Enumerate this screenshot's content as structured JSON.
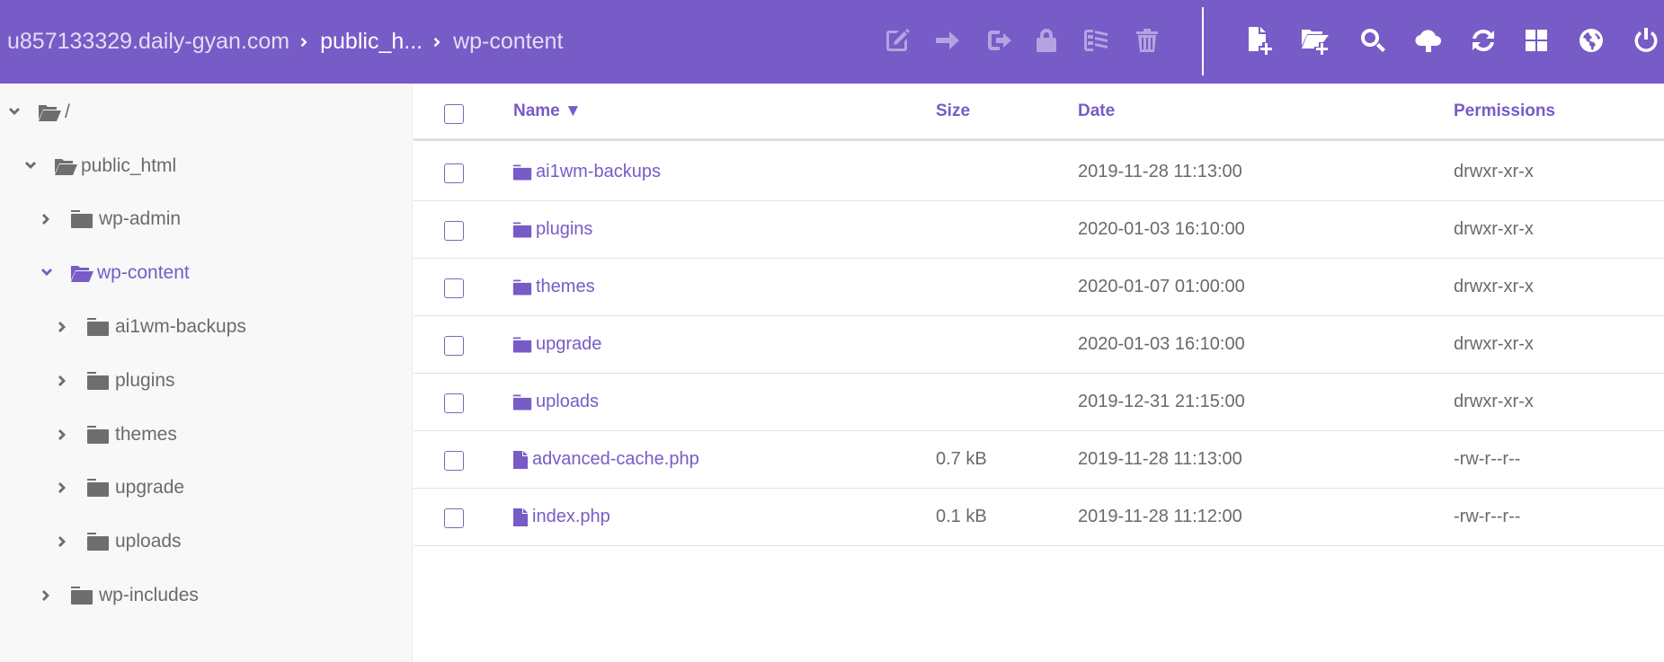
{
  "header": {
    "breadcrumb": [
      {
        "label": "u857133329.daily-gyan.com"
      },
      {
        "label": "public_h..."
      },
      {
        "label": "wp-content"
      }
    ],
    "toolbar_selection_actions": [
      {
        "icon": "edit-icon",
        "label": "Rename",
        "enabled": false
      },
      {
        "icon": "arrow-right-icon",
        "label": "Move",
        "enabled": false
      },
      {
        "icon": "copy-icon",
        "label": "Copy",
        "enabled": false
      },
      {
        "icon": "lock-icon",
        "label": "Permissions",
        "enabled": false
      },
      {
        "icon": "archive-icon",
        "label": "Archive",
        "enabled": false
      },
      {
        "icon": "trash-icon",
        "label": "Delete",
        "enabled": false
      }
    ],
    "toolbar_actions": [
      {
        "icon": "new-file-icon",
        "label": "New file"
      },
      {
        "icon": "new-folder-icon",
        "label": "New folder"
      },
      {
        "icon": "search-icon",
        "label": "Search"
      },
      {
        "icon": "upload-icon",
        "label": "Upload"
      },
      {
        "icon": "refresh-icon",
        "label": "Refresh"
      },
      {
        "icon": "grid-view-icon",
        "label": "Grid view"
      },
      {
        "icon": "globe-icon",
        "label": "Website"
      },
      {
        "icon": "power-icon",
        "label": "Logout"
      }
    ],
    "colors": {
      "accent": "#775bc7",
      "disabled_icon": "#b3a4e0"
    }
  },
  "sidebar": {
    "tree": [
      {
        "label": "/",
        "level": 0,
        "expanded": true,
        "active": false
      },
      {
        "label": "public_html",
        "level": 1,
        "expanded": true,
        "active": false
      },
      {
        "label": "wp-admin",
        "level": 2,
        "expanded": false,
        "active": false
      },
      {
        "label": "wp-content",
        "level": 2,
        "expanded": true,
        "active": true
      },
      {
        "label": "ai1wm-backups",
        "level": 3,
        "expanded": false,
        "active": false
      },
      {
        "label": "plugins",
        "level": 3,
        "expanded": false,
        "active": false
      },
      {
        "label": "themes",
        "level": 3,
        "expanded": false,
        "active": false
      },
      {
        "label": "upgrade",
        "level": 3,
        "expanded": false,
        "active": false
      },
      {
        "label": "uploads",
        "level": 3,
        "expanded": false,
        "active": false
      },
      {
        "label": "wp-includes",
        "level": 2,
        "expanded": false,
        "active": false
      }
    ]
  },
  "table": {
    "columns": {
      "name": "Name ▼",
      "size": "Size",
      "date": "Date",
      "permissions": "Permissions"
    },
    "rows": [
      {
        "type": "folder",
        "name": "ai1wm-backups",
        "size": "",
        "date": "2019-11-28 11:13:00",
        "permissions": "drwxr-xr-x"
      },
      {
        "type": "folder",
        "name": "plugins",
        "size": "",
        "date": "2020-01-03 16:10:00",
        "permissions": "drwxr-xr-x"
      },
      {
        "type": "folder",
        "name": "themes",
        "size": "",
        "date": "2020-01-07 01:00:00",
        "permissions": "drwxr-xr-x"
      },
      {
        "type": "folder",
        "name": "upgrade",
        "size": "",
        "date": "2020-01-03 16:10:00",
        "permissions": "drwxr-xr-x"
      },
      {
        "type": "folder",
        "name": "uploads",
        "size": "",
        "date": "2019-12-31 21:15:00",
        "permissions": "drwxr-xr-x"
      },
      {
        "type": "file",
        "name": "advanced-cache.php",
        "size": "0.7 kB",
        "date": "2019-11-28 11:13:00",
        "permissions": "-rw-r--r--"
      },
      {
        "type": "file",
        "name": "index.php",
        "size": "0.1 kB",
        "date": "2019-11-28 11:12:00",
        "permissions": "-rw-r--r--"
      }
    ]
  }
}
